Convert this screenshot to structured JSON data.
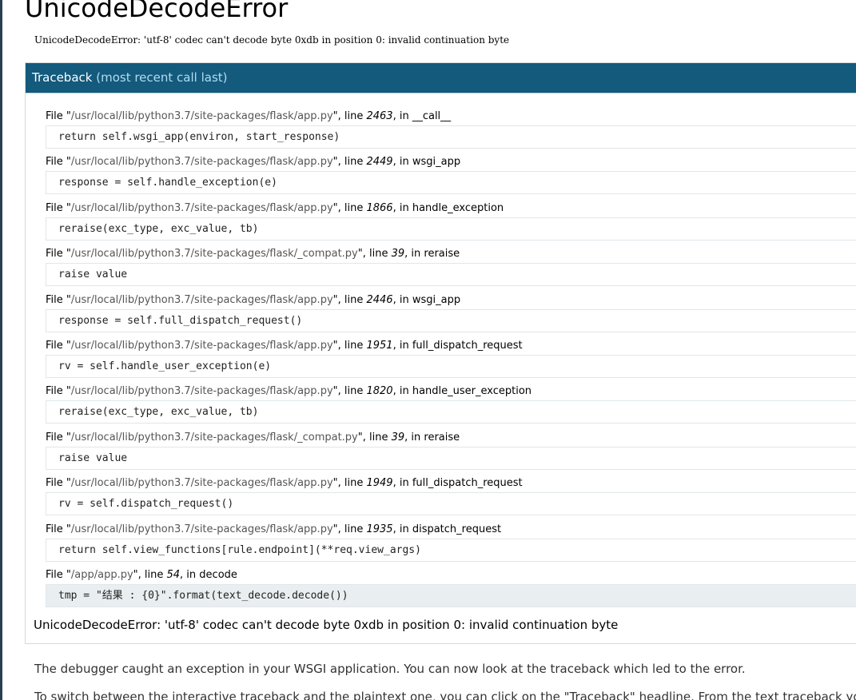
{
  "title": "UnicodeDecodeError",
  "error_message": "UnicodeDecodeError: 'utf-8' codec can't decode byte 0xdb in position 0: invalid continuation byte",
  "traceback": {
    "heading": "Traceback",
    "heading_sub": "(most recent call last)",
    "frames": [
      {
        "file_prefix": "File \"",
        "path": "/usr/local/lib/python3.7/site-packages/flask/app.py",
        "line_label": "\", line ",
        "line": "2463",
        "in_label": ", in ",
        "func": "__call__",
        "code": "return self.wsgi_app(environ, start_response)"
      },
      {
        "file_prefix": "File \"",
        "path": "/usr/local/lib/python3.7/site-packages/flask/app.py",
        "line_label": "\", line ",
        "line": "2449",
        "in_label": ", in ",
        "func": "wsgi_app",
        "code": "response = self.handle_exception(e)"
      },
      {
        "file_prefix": "File \"",
        "path": "/usr/local/lib/python3.7/site-packages/flask/app.py",
        "line_label": "\", line ",
        "line": "1866",
        "in_label": ", in ",
        "func": "handle_exception",
        "code": "reraise(exc_type, exc_value, tb)"
      },
      {
        "file_prefix": "File \"",
        "path": "/usr/local/lib/python3.7/site-packages/flask/_compat.py",
        "line_label": "\", line ",
        "line": "39",
        "in_label": ", in ",
        "func": "reraise",
        "code": "raise value"
      },
      {
        "file_prefix": "File \"",
        "path": "/usr/local/lib/python3.7/site-packages/flask/app.py",
        "line_label": "\", line ",
        "line": "2446",
        "in_label": ", in ",
        "func": "wsgi_app",
        "code": "response = self.full_dispatch_request()"
      },
      {
        "file_prefix": "File \"",
        "path": "/usr/local/lib/python3.7/site-packages/flask/app.py",
        "line_label": "\", line ",
        "line": "1951",
        "in_label": ", in ",
        "func": "full_dispatch_request",
        "code": "rv = self.handle_user_exception(e)"
      },
      {
        "file_prefix": "File \"",
        "path": "/usr/local/lib/python3.7/site-packages/flask/app.py",
        "line_label": "\", line ",
        "line": "1820",
        "in_label": ", in ",
        "func": "handle_user_exception",
        "code": "reraise(exc_type, exc_value, tb)"
      },
      {
        "file_prefix": "File \"",
        "path": "/usr/local/lib/python3.7/site-packages/flask/_compat.py",
        "line_label": "\", line ",
        "line": "39",
        "in_label": ", in ",
        "func": "reraise",
        "code": "raise value"
      },
      {
        "file_prefix": "File \"",
        "path": "/usr/local/lib/python3.7/site-packages/flask/app.py",
        "line_label": "\", line ",
        "line": "1949",
        "in_label": ", in ",
        "func": "full_dispatch_request",
        "code": "rv = self.dispatch_request()"
      },
      {
        "file_prefix": "File \"",
        "path": "/usr/local/lib/python3.7/site-packages/flask/app.py",
        "line_label": "\", line ",
        "line": "1935",
        "in_label": ", in ",
        "func": "dispatch_request",
        "code": "return self.view_functions[rule.endpoint](**req.view_args)"
      },
      {
        "file_prefix": "File \"",
        "path": "/app/app.py",
        "line_label": "\", line ",
        "line": "54",
        "in_label": ", in ",
        "func": "decode",
        "code": "tmp = \"结果 : {0}\".format(text_decode.decode())"
      }
    ],
    "final_exception": "UnicodeDecodeError: 'utf-8' codec can't decode byte 0xdb in position 0: invalid continuation byte"
  },
  "explanation": {
    "p1": "The debugger caught an exception in your WSGI application. You can now look at the traceback which led to the error.",
    "p2": "To switch between the interactive traceback and the plaintext one, you can click on the \"Traceback\" headline. From the text traceback you can"
  },
  "colors": {
    "header_bg": "#135a7d",
    "header_sub": "#b2ddf0",
    "left_bar": "#2a3e55"
  }
}
